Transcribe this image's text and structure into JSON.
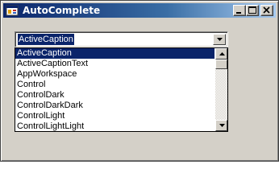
{
  "window": {
    "title": "AutoComplete",
    "icon": "app-form-icon",
    "controls": [
      "minimize-icon",
      "maximize-icon",
      "close-icon"
    ]
  },
  "combobox": {
    "value": "ActiveCaption",
    "arrow_icon": "chevron-down-icon"
  },
  "dropdown": {
    "selected_index": 0,
    "items": [
      "ActiveCaption",
      "ActiveCaptionText",
      "AppWorkspace",
      "Control",
      "ControlDark",
      "ControlDarkDark",
      "ControlLight",
      "ControlLightLight"
    ]
  },
  "colors": {
    "titlebar_start": "#0a246a",
    "titlebar_end": "#a6caf0",
    "selection": "#0a246a",
    "face": "#d4d0c8"
  }
}
